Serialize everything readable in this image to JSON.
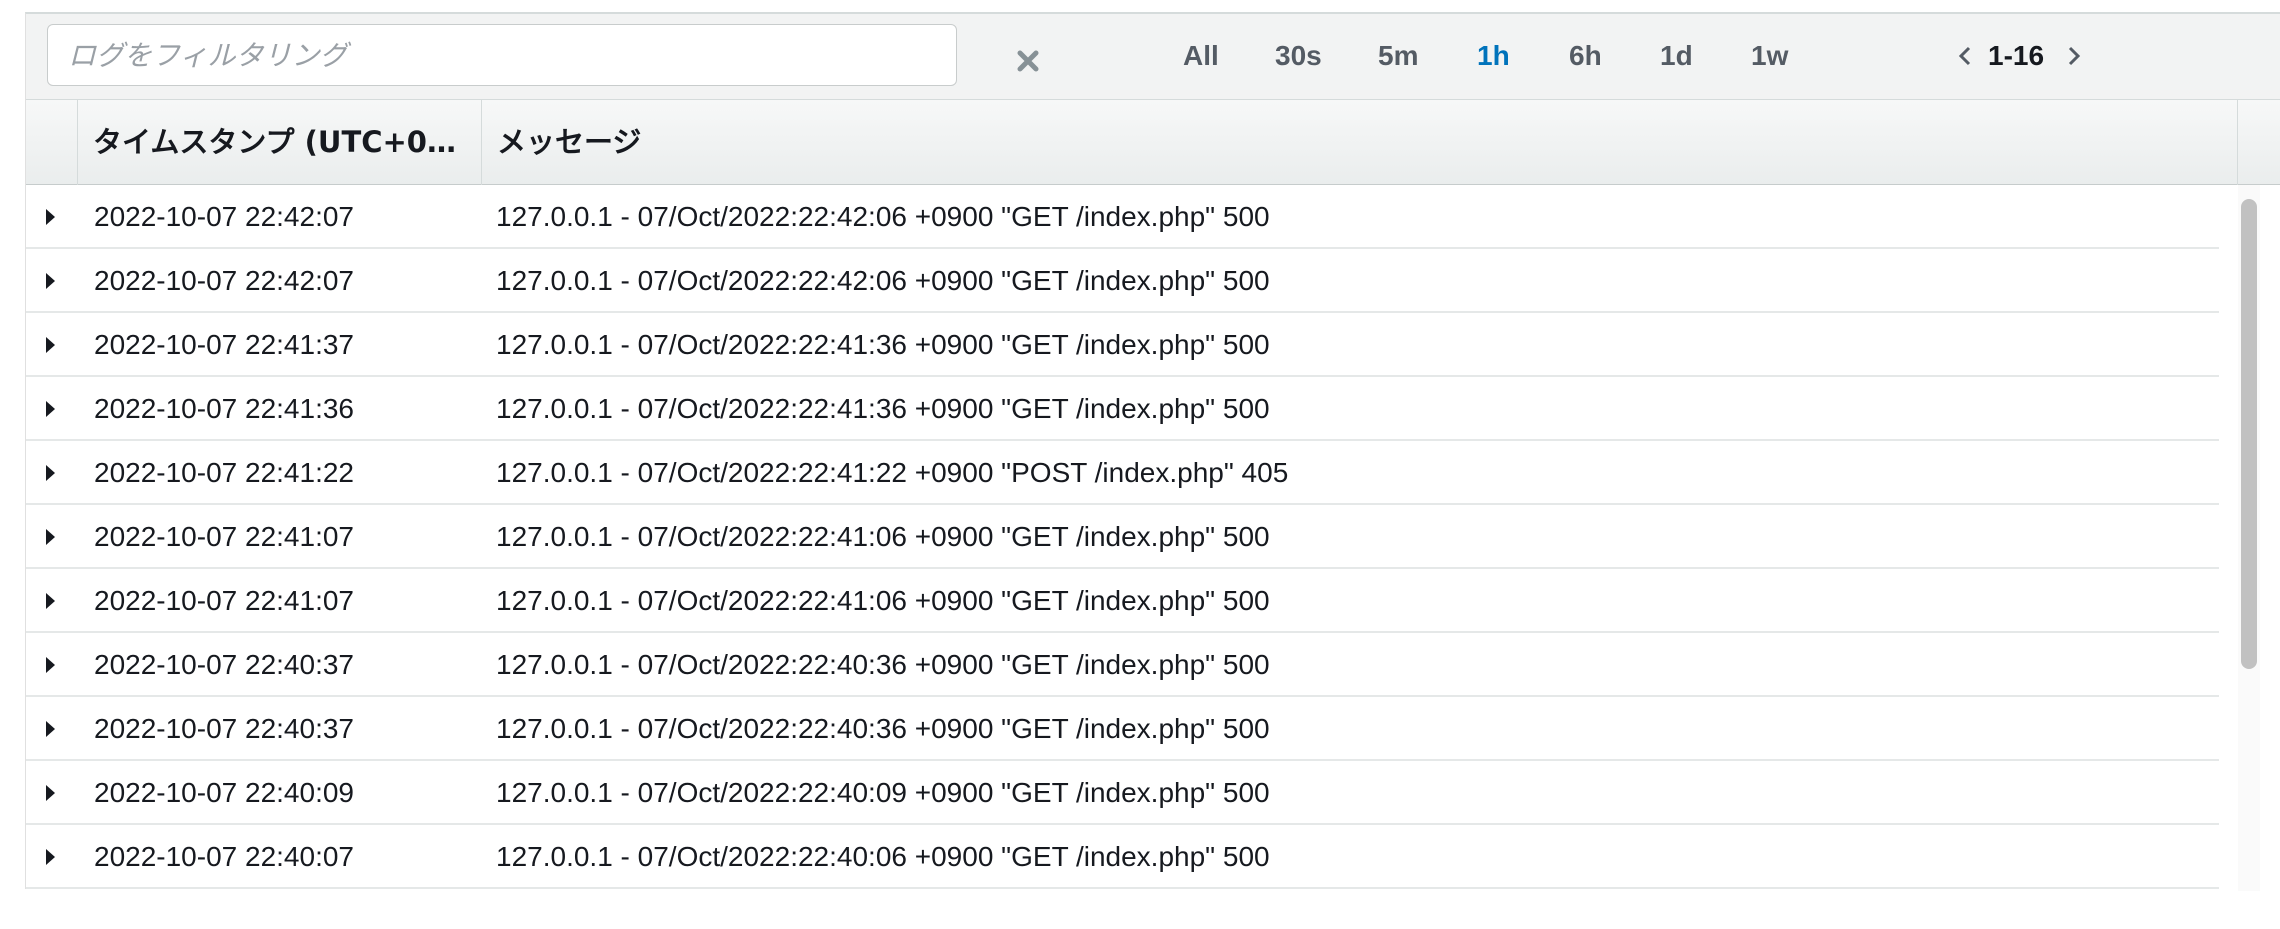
{
  "filter": {
    "placeholder": "ログをフィルタリング",
    "value": ""
  },
  "toolbar": {
    "clear_icon": "close-icon",
    "ranges": [
      "All",
      "30s",
      "5m",
      "1h",
      "6h",
      "1d",
      "1w"
    ],
    "active_range": "1h",
    "active_color": "#0073bb"
  },
  "pager": {
    "label": "1-16",
    "prev_icon": "chevron-left-icon",
    "next_icon": "chevron-right-icon"
  },
  "table": {
    "columns": {
      "timestamp": "タイムスタンプ (UTC+00:...",
      "message": "メッセージ"
    },
    "rows": [
      {
        "timestamp": "2022-10-07 22:42:07",
        "message": "127.0.0.1 - 07/Oct/2022:22:42:06 +0900 \"GET /index.php\" 500"
      },
      {
        "timestamp": "2022-10-07 22:42:07",
        "message": "127.0.0.1 - 07/Oct/2022:22:42:06 +0900 \"GET /index.php\" 500"
      },
      {
        "timestamp": "2022-10-07 22:41:37",
        "message": "127.0.0.1 - 07/Oct/2022:22:41:36 +0900 \"GET /index.php\" 500"
      },
      {
        "timestamp": "2022-10-07 22:41:36",
        "message": "127.0.0.1 - 07/Oct/2022:22:41:36 +0900 \"GET /index.php\" 500"
      },
      {
        "timestamp": "2022-10-07 22:41:22",
        "message": "127.0.0.1 - 07/Oct/2022:22:41:22 +0900 \"POST /index.php\" 405"
      },
      {
        "timestamp": "2022-10-07 22:41:07",
        "message": "127.0.0.1 - 07/Oct/2022:22:41:06 +0900 \"GET /index.php\" 500"
      },
      {
        "timestamp": "2022-10-07 22:41:07",
        "message": "127.0.0.1 - 07/Oct/2022:22:41:06 +0900 \"GET /index.php\" 500"
      },
      {
        "timestamp": "2022-10-07 22:40:37",
        "message": "127.0.0.1 - 07/Oct/2022:22:40:36 +0900 \"GET /index.php\" 500"
      },
      {
        "timestamp": "2022-10-07 22:40:37",
        "message": "127.0.0.1 - 07/Oct/2022:22:40:36 +0900 \"GET /index.php\" 500"
      },
      {
        "timestamp": "2022-10-07 22:40:09",
        "message": "127.0.0.1 - 07/Oct/2022:22:40:09 +0900 \"GET /index.php\" 500"
      },
      {
        "timestamp": "2022-10-07 22:40:07",
        "message": "127.0.0.1 - 07/Oct/2022:22:40:06 +0900 \"GET /index.php\" 500"
      }
    ]
  }
}
